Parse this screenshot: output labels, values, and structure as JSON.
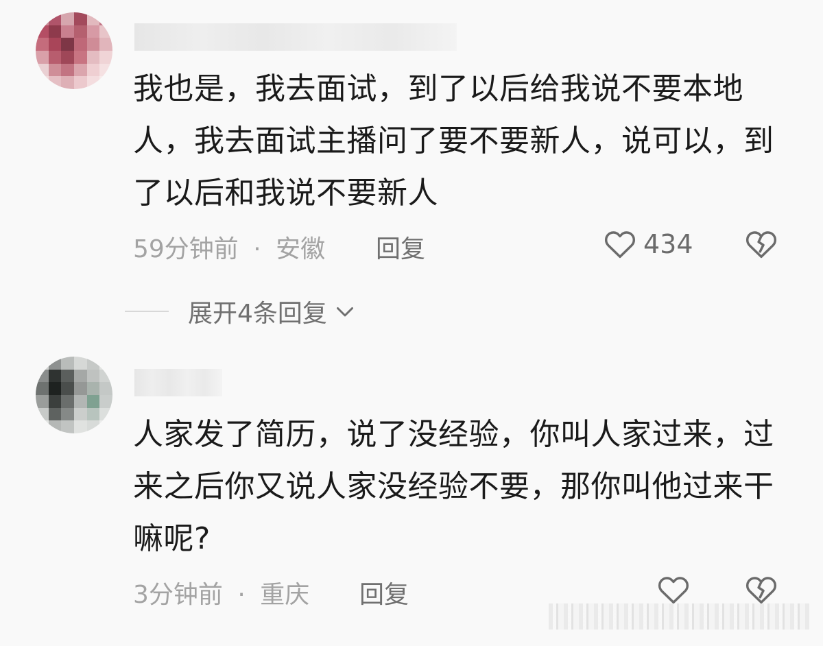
{
  "comments": [
    {
      "text": "我也是，我去面试，到了以后给我说不要本地人，我去面试主播问了要不要新人，说可以，到了以后和我说不要新人",
      "time": "59分钟前",
      "separator": "·",
      "location": "安徽",
      "reply_label": "回复",
      "like_count": "434"
    },
    {
      "text": "人家发了简历，说了没经验，你叫人家过来，过来之后你又说人家没经验不要，那你叫他过来干嘛呢?",
      "time": "3分钟前",
      "separator": "·",
      "location": "重庆",
      "reply_label": "回复",
      "like_count": ""
    }
  ],
  "expand_replies": {
    "label": "展开4条回复",
    "icon": "chevron-down-icon"
  },
  "icons": {
    "like": "heart-outline-icon",
    "dislike": "broken-heart-icon"
  },
  "colors": {
    "background": "#f9f9f9",
    "text": "#1a1a1a",
    "meta": "#a3a3a3",
    "action": "#707070"
  }
}
